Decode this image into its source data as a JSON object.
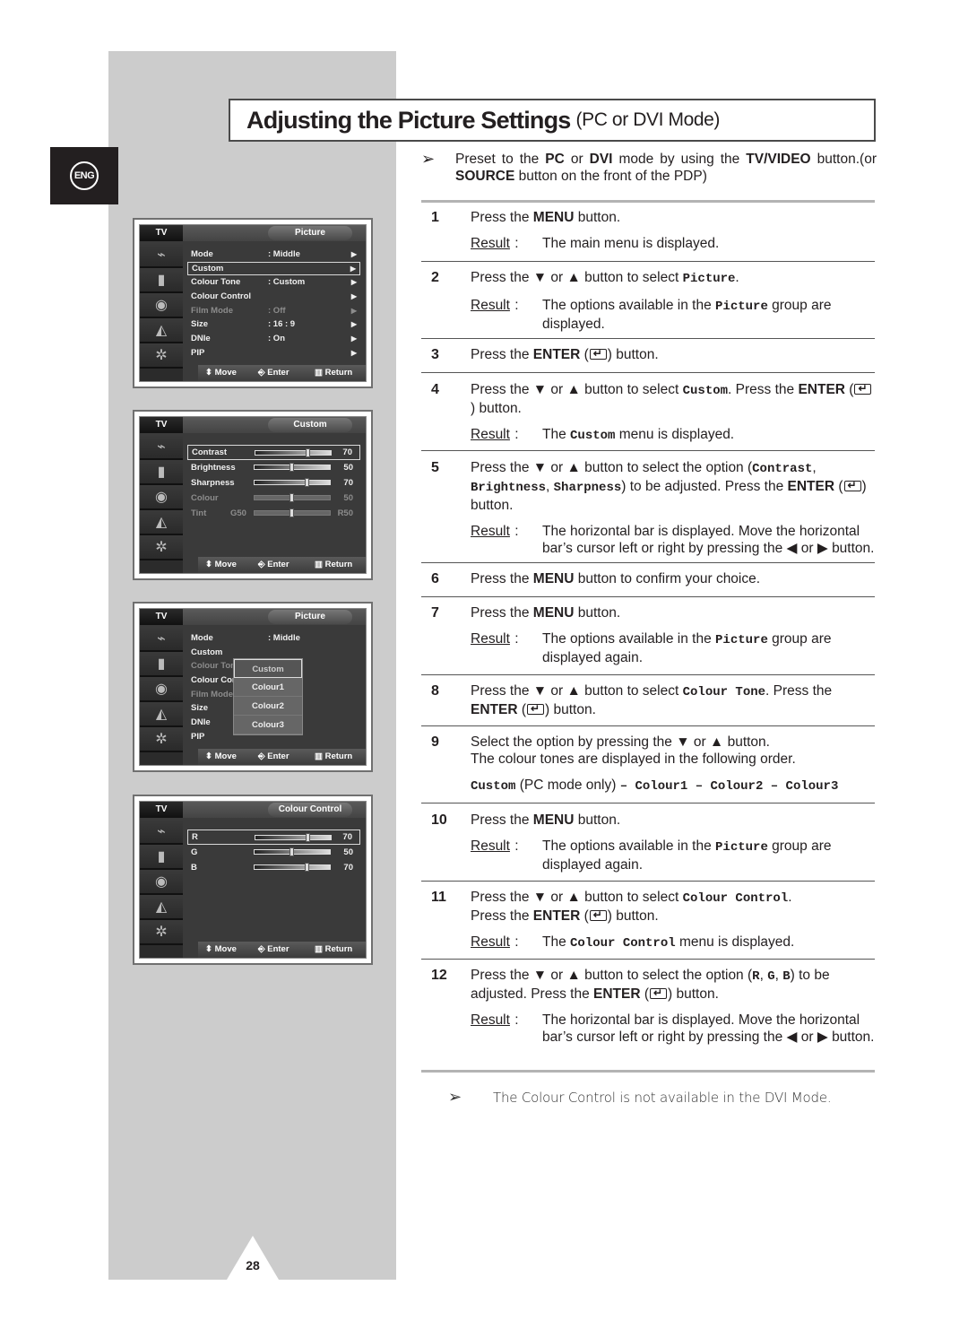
{
  "language_badge": "ENG",
  "title": {
    "main": "Adjusting the Picture Settings",
    "sub": "(PC or DVI Mode)"
  },
  "preset_note": {
    "parts": [
      "Preset to the ",
      "PC",
      " or ",
      "DVI",
      " mode by using the ",
      "TV/VIDEO",
      " button.(or ",
      "SOURCE",
      " button on the front of the PDP)"
    ]
  },
  "steps": [
    {
      "num": "1",
      "text": "Press the <b>MENU</b> button.",
      "result": "The main menu is displayed."
    },
    {
      "num": "2",
      "text": "Press the ▼ or ▲ button to select <m>Picture</m>.",
      "result": "The options available in the <m>Picture</m> group are displayed."
    },
    {
      "num": "3",
      "text": "Press the <b>ENTER</b> (<e>) button."
    },
    {
      "num": "4",
      "text": "Press the ▼ or ▲ button to select <m>Custom</m>. Press the <b>ENTER</b> (<e>) button.",
      "result": "The <m>Custom</m> menu is displayed."
    },
    {
      "num": "5",
      "text": "Press the ▼ or ▲ button to select the option (<m>Contrast</m>, <m>Brightness</m>, <m>Sharpness</m>) to be adjusted. Press the <b>ENTER</b> (<e>) button.",
      "result": "The horizontal bar is displayed. Move the horizontal bar’s cursor left or right by pressing the ◀ or ▶ button."
    },
    {
      "num": "6",
      "text": "Press the <b>MENU</b> button to confirm your choice."
    },
    {
      "num": "7",
      "text": "Press the <b>MENU</b> button.",
      "result": "The options available in the <m>Picture</m> group are displayed again."
    },
    {
      "num": "8",
      "text": "Press the ▼ or ▲ button to select <m>Colour Tone</m>. Press the <b>ENTER</b> (<e>) button."
    },
    {
      "num": "9",
      "text": "Select the option by pressing the ▼ or ▲ button.<br>The colour tones are displayed in the following order.",
      "sequence": "<m>Custom</m> (PC mode only) <m>– Colour1 – Colour2 – Colour3</m>"
    },
    {
      "num": "10",
      "text": "Press the <b>MENU</b> button.",
      "result": "The options available in the <m>Picture</m> group are displayed again."
    },
    {
      "num": "11",
      "text": "Press the ▼ or ▲ button to select <m>Colour Control</m>.<br>Press the <b>ENTER</b> (<e>) button.",
      "result": "The <m>Colour Control</m> menu is displayed."
    },
    {
      "num": "12",
      "text": "Press the ▼ or ▲ button to select the option (<m>R</m>, <m>G</m>, <m>B</m>) to be adjusted. Press the <b>ENTER</b> (<e>) button.",
      "result": "The horizontal bar is displayed. Move the horizontal bar’s cursor left or right by pressing the ◀ or ▶ button."
    }
  ],
  "result_label": "Result",
  "bottom_note": "The Colour Control is not available in the DVI Mode.",
  "page_number": "28",
  "osd_common": {
    "tv_label": "TV",
    "footer": {
      "move": "Move",
      "enter": "Enter",
      "return": "Return"
    },
    "side_icons": [
      "antenna-icon",
      "picture-icon",
      "sound-icon",
      "channel-icon",
      "setup-icon"
    ]
  },
  "osd_picture": {
    "title": "Picture",
    "rows": [
      {
        "label": "Mode",
        "value": ": Middle",
        "arrow": true
      },
      {
        "label": "Custom",
        "value": "",
        "arrow": true,
        "selected": true
      },
      {
        "label": "Colour Tone",
        "value": ": Custom",
        "arrow": true
      },
      {
        "label": "Colour Control",
        "value": "",
        "arrow": true
      },
      {
        "label": "Film Mode",
        "value": ": Off",
        "arrow": true,
        "dim": true
      },
      {
        "label": "Size",
        "value": ": 16 : 9",
        "arrow": true
      },
      {
        "label": "DNIe",
        "value": ": On",
        "arrow": true
      },
      {
        "label": "PIP",
        "value": "",
        "arrow": true
      }
    ]
  },
  "osd_custom": {
    "title": "Custom",
    "sliders": [
      {
        "label": "Contrast",
        "value": 70,
        "selected": true
      },
      {
        "label": "Brightness",
        "value": 50
      },
      {
        "label": "Sharpness",
        "value": 70
      },
      {
        "label": "Colour",
        "value": 50,
        "dim": true
      },
      {
        "label": "Tint",
        "value": 50,
        "dim": true,
        "low": "G50",
        "high": "R50"
      }
    ]
  },
  "osd_tone": {
    "title": "Picture",
    "rows": [
      {
        "label": "Mode",
        "value": ": Middle"
      },
      {
        "label": "Custom",
        "value": ""
      },
      {
        "label": "Colour Tone",
        "value": ":",
        "dim": true
      },
      {
        "label": "Colour Control",
        "value": ""
      },
      {
        "label": "Film Mode",
        "value": ":",
        "dim": true
      },
      {
        "label": "Size",
        "value": ":"
      },
      {
        "label": "DNIe",
        "value": ":"
      },
      {
        "label": "PIP",
        "value": ""
      }
    ],
    "popup_options": [
      "Custom",
      "Colour1",
      "Colour2",
      "Colour3"
    ],
    "popup_selected": "Custom"
  },
  "osd_colour": {
    "title": "Colour Control",
    "sliders": [
      {
        "label": "R",
        "value": 70,
        "selected": true
      },
      {
        "label": "G",
        "value": 50
      },
      {
        "label": "B",
        "value": 70
      }
    ]
  }
}
